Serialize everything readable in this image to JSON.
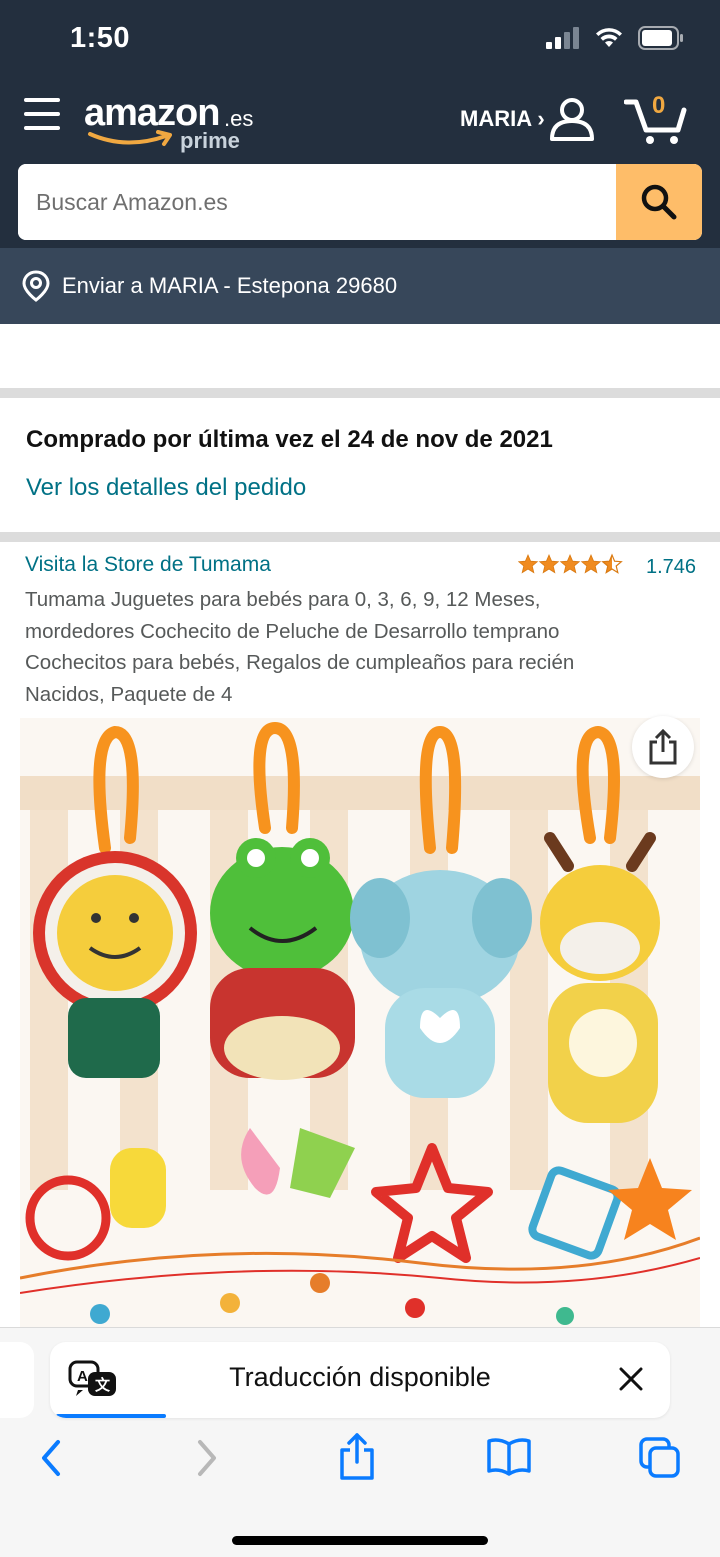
{
  "status_bar": {
    "time": "1:50"
  },
  "header": {
    "logo_word": "amazon",
    "logo_tld": ".es",
    "logo_sub": "prime",
    "user_label": "MARIA ›",
    "cart_count": "0"
  },
  "search": {
    "placeholder": "Buscar Amazon.es"
  },
  "deliver": {
    "text": "Enviar a MARIA - Estepona 29680"
  },
  "order": {
    "purchased_text": "Comprado por última vez el 24 de nov de 2021",
    "details_link": "Ver los detalles del pedido"
  },
  "product": {
    "store_link": "Visita la Store de Tumama",
    "rating_stars": 4.5,
    "rating_count": "1.746",
    "title": "Tumama Juguetes para bebés para 0, 3, 6, 9, 12 Meses, mordedores Cochecito de Peluche de Desarrollo temprano Cochecitos para bebés, Regalos de cumpleaños para recién Nacidos, Paquete de 4"
  },
  "translation": {
    "text": "Traducción disponible"
  },
  "icons": {
    "menu": "menu-icon",
    "user": "user-icon",
    "cart": "cart-icon",
    "search": "search-icon",
    "location": "location-pin-icon",
    "share": "share-icon",
    "translate": "translate-icon",
    "close": "close-icon",
    "back": "chevron-left-icon",
    "forward": "chevron-right-icon",
    "bookmarks": "book-icon",
    "tabs": "tabs-icon"
  },
  "colors": {
    "header_bg": "#232f3e",
    "deliver_bg": "#37475a",
    "search_button": "#febd69",
    "link": "#007185",
    "star": "#f08b1f",
    "safari_blue": "#0a7bff"
  }
}
